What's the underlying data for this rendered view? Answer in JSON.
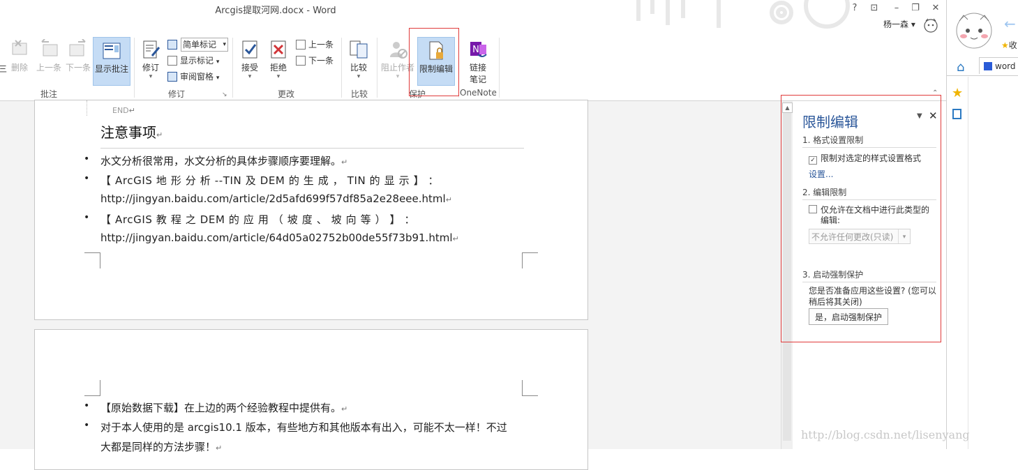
{
  "window": {
    "title": "Arcgis提取河网.docx - Word",
    "help": "?",
    "user": "杨一森"
  },
  "ribbon": {
    "comments": {
      "delete": "删除",
      "prev": "上一条",
      "next": "下一条",
      "show": "显示批注",
      "group": "批注"
    },
    "tracking": {
      "track": "修订",
      "markup_select": "简单标记",
      "show_markup": "显示标记",
      "review_pane": "审阅窗格",
      "group": "修订"
    },
    "changes": {
      "accept": "接受",
      "reject": "拒绝",
      "prev": "上一条",
      "next": "下一条",
      "group": "更改"
    },
    "compare": {
      "compare": "比较",
      "group": "比较"
    },
    "protect": {
      "block_authors": "阻止作者",
      "restrict_editing": "限制编辑",
      "group": "保护"
    },
    "onenote": {
      "linked_notes_1": "链接",
      "linked_notes_2": "笔记",
      "group": "OneNote"
    },
    "left_cut": "三"
  },
  "document": {
    "end_mark": "END",
    "heading": "注意事项",
    "bullets": [
      "水文分析很常用，水文分析的具体步骤顺序要理解。",
      "【 ArcGIS  地 形 分 析 --TIN  及  DEM  的 生 成 ， TIN  的 显 示 】 ：",
      "http://jingyan.baidu.com/article/2d5afd699f57df85a2e28eee.html",
      "【 ArcGIS  教 程 之  DEM  的 应 用 （ 坡 度 、 坡 向 等 ） 】 ：",
      "http://jingyan.baidu.com/article/64d05a02752b00de55f73b91.html"
    ],
    "page2_bullets": [
      "【原始数据下载】在上边的两个经验教程中提供有。",
      "对于本人使用的是 arcgis10.1 版本，有些地方和其他版本有出入，可能不太一样！不过",
      "大都是同样的方法步骤！"
    ]
  },
  "pane": {
    "title": "限制编辑",
    "section1": "1. 格式设置限制",
    "format_checkbox": "限制对选定的样式设置格式",
    "format_checked": true,
    "settings_link": "设置...",
    "section2": "2. 编辑限制",
    "edit_checkbox_1": "仅允许在文档中进行此类型的",
    "edit_checkbox_2": "编辑:",
    "edit_checked": false,
    "edit_select": "不允许任何更改(只读)",
    "section3": "3. 启动强制保护",
    "prompt_1": "您是否准备应用这些设置? (您可以",
    "prompt_2": "稍后将其关闭)",
    "enforce_button": "是，启动强制保护"
  },
  "browser": {
    "tab_text": "word",
    "side_text": "收"
  },
  "watermark": "http://blog.csdn.net/lisenyang",
  "colors": {
    "accent": "#2b579a",
    "highlight": "#c5dcf5",
    "annotation_red": "#e03a3a"
  }
}
